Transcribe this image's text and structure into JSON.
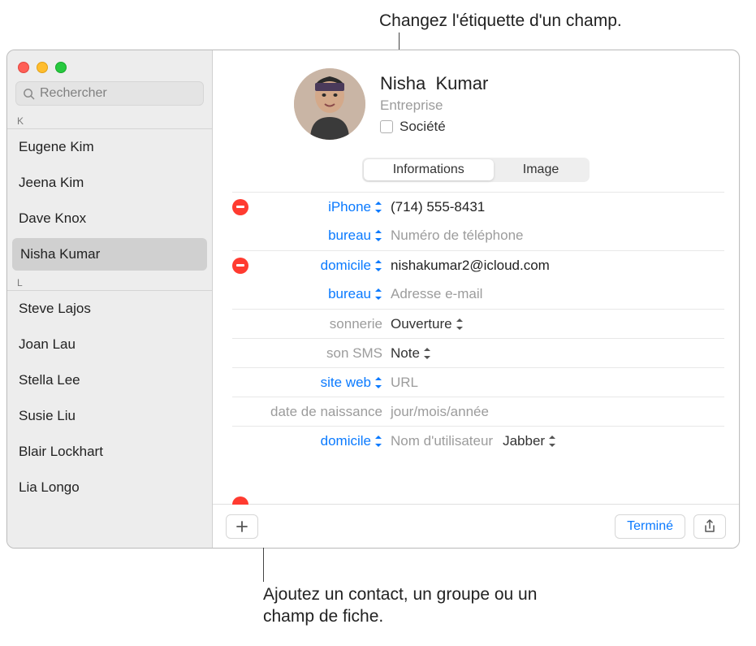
{
  "annotations": {
    "top": "Changez l'étiquette d'un champ.",
    "bottom": "Ajoutez un contact, un groupe ou un champ de fiche."
  },
  "search": {
    "placeholder": "Rechercher"
  },
  "sections": {
    "k": {
      "letter": "K",
      "items": [
        "Eugene Kim",
        "Jeena Kim",
        "Dave Knox",
        "Nisha Kumar"
      ]
    },
    "l": {
      "letter": "L",
      "items": [
        "Steve Lajos",
        "Joan Lau",
        "Stella Lee",
        "Susie Liu",
        "Blair Lockhart",
        "Lia Longo"
      ]
    }
  },
  "card": {
    "first_name": "Nisha",
    "last_name": "Kumar",
    "company_placeholder": "Entreprise",
    "society_label": "Société"
  },
  "segment": {
    "info": "Informations",
    "image": "Image"
  },
  "fields": {
    "phone_iphone_label": "iPhone",
    "phone_iphone_value": "(714) 555-8431",
    "phone_bureau_label": "bureau",
    "phone_bureau_placeholder": "Numéro de téléphone",
    "email_home_label": "domicile",
    "email_home_value": "nishakumar2@icloud.com",
    "email_bureau_label": "bureau",
    "email_bureau_placeholder": "Adresse e-mail",
    "ringtone_label": "sonnerie",
    "ringtone_value": "Ouverture",
    "texttone_label": "son SMS",
    "texttone_value": "Note",
    "website_label": "site web",
    "website_placeholder": "URL",
    "birthday_label": "date de naissance",
    "birthday_placeholder": "jour/mois/année",
    "im_label": "domicile",
    "im_placeholder": "Nom d'utilisateur",
    "im_service": "Jabber"
  },
  "footer": {
    "done": "Terminé"
  }
}
